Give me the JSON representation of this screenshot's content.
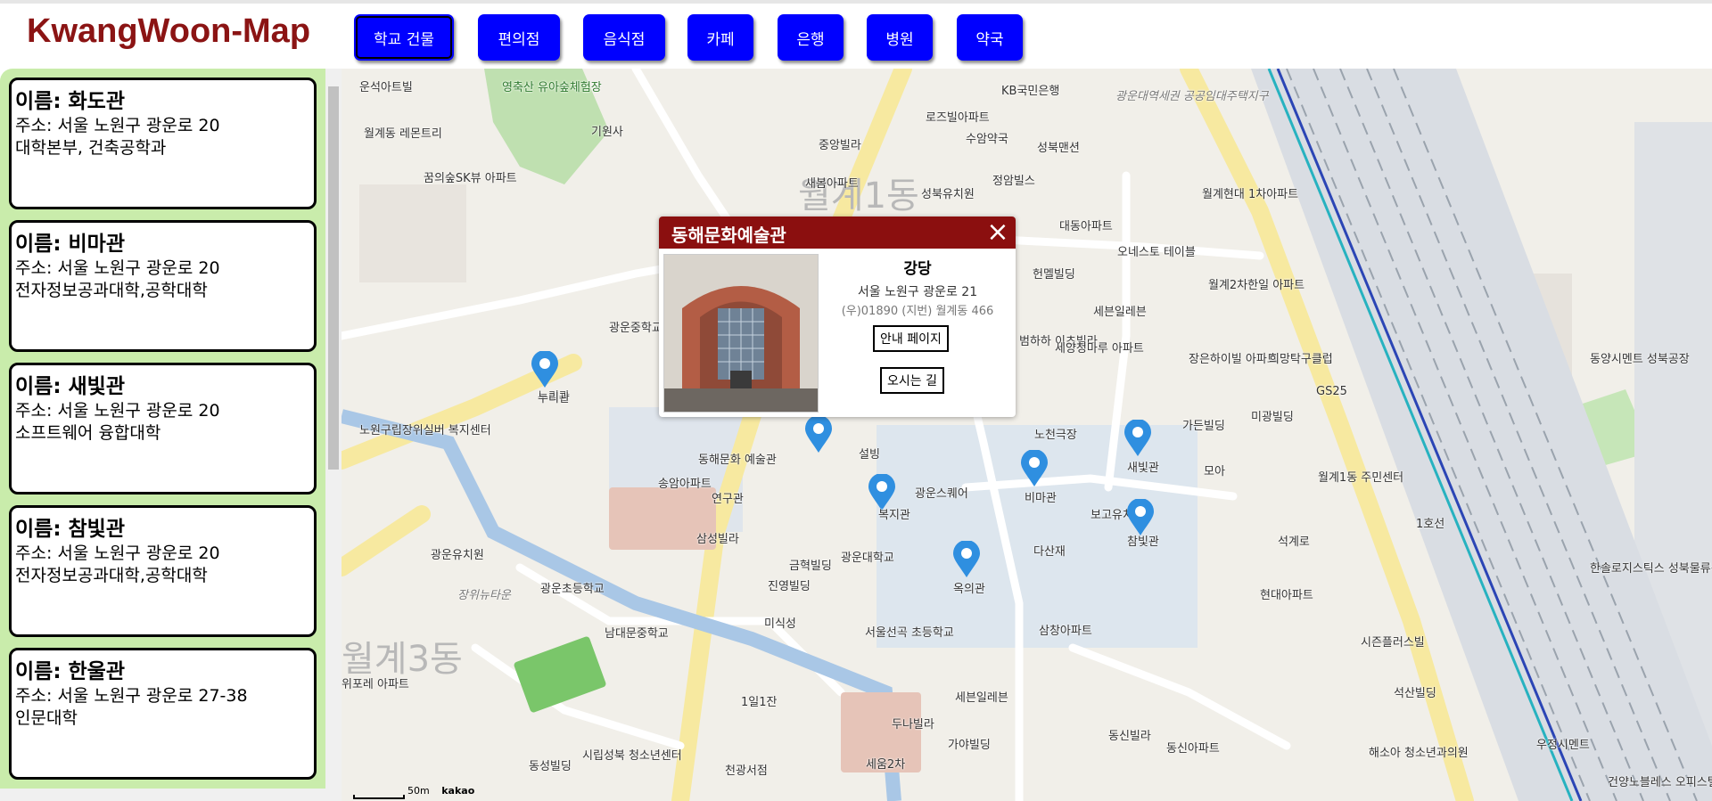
{
  "app": {
    "title": "KwangWoon-Map"
  },
  "categories": [
    {
      "label": "학교 건물",
      "active": true
    },
    {
      "label": "편의점",
      "active": false
    },
    {
      "label": "음식점",
      "active": false
    },
    {
      "label": "카페",
      "active": false
    },
    {
      "label": "은행",
      "active": false
    },
    {
      "label": "병원",
      "active": false
    },
    {
      "label": "약국",
      "active": false
    }
  ],
  "buildings": [
    {
      "name": "이름: 화도관",
      "address": "주소: 서울 노원구 광운로 20",
      "desc": "대학본부, 건축공학과"
    },
    {
      "name": "이름: 비마관",
      "address": "주소: 서울 노원구 광운로 20",
      "desc": "전자정보공과대학,공학대학"
    },
    {
      "name": "이름: 새빛관",
      "address": "주소: 서울 노원구 광운로 20",
      "desc": "소프트웨어 융합대학"
    },
    {
      "name": "이름: 참빛관",
      "address": "주소: 서울 노원구 광운로 20",
      "desc": "전자정보공과대학,공학대학"
    },
    {
      "name": "이름: 한울관",
      "address": "주소: 서울 노원구 광운로 27-38",
      "desc": "인문대학"
    }
  ],
  "popup": {
    "title": "동해문화예술관",
    "category": "강당",
    "address": "서울 노원구 광운로 21",
    "postal": "(우)01890 (지번) 월계동 466",
    "info_button": "안내 페이지",
    "directions_button": "오시는 길"
  },
  "map": {
    "scale": "50m",
    "provider": "kakao",
    "district_labels": [
      "월계1동",
      "월계3동"
    ],
    "markers": [
      "누리관",
      "동해문화예술관",
      "복지관",
      "비마관",
      "새빛관",
      "참빛관",
      "옥의관"
    ],
    "labels": [
      "운석아트빌",
      "영축산 유아숲체험장",
      "기원사",
      "KB국민은행",
      "로즈빌아파트",
      "수암약국",
      "성북맨션",
      "중앙빌라",
      "새봄아파트",
      "정암빌스",
      "성북유치원",
      "꿈의숲SK뷰 아파트",
      "월계동 레몬트리",
      "광운대역세권 공공임대주택지구",
      "대동아파트",
      "오네스토 테이블",
      "헌멜빌딩",
      "세븐일레븐",
      "월계2차한일 아파트",
      "월계현대 1차아파트",
      "광운중학교",
      "범하하 이츠빌라",
      "세양청마루 아파트",
      "장은하이빌 아파트",
      "희망탁구클럽",
      "GS25",
      "동양시멘트 성북공장",
      "노원구립장위실버 복지센터",
      "누리관",
      "설빙",
      "동해문화 예술관",
      "연구관",
      "송암아파트",
      "광운스퀘어",
      "노천극장",
      "가든빌딩",
      "미광빌딩",
      "모아",
      "월계1동 주민센터",
      "보고유치원",
      "광운유치원",
      "삼성빌라",
      "금혁빌딩",
      "진영빌딩",
      "미식성",
      "광운대학교",
      "다산재",
      "현대아파트",
      "한솔로지스틱스 성북물류센터",
      "광운초등학교",
      "남대문중학교",
      "장위뉴타운",
      "서울선곡 초등학교",
      "삼창아파트",
      "시즌플러스빌",
      "세븐일레븐",
      "두나빌라",
      "석산빌딩",
      "1일1잔",
      "세움2차",
      "가야빌딩",
      "동신빌라",
      "동신아파트",
      "해소아 청소년과의원",
      "우정시멘트",
      "동성빌딩",
      "시립성북 청소년센터",
      "천광서점",
      "건양노블레스 오피스텔",
      "위포레 아파트",
      "석계로",
      "1호선"
    ]
  }
}
